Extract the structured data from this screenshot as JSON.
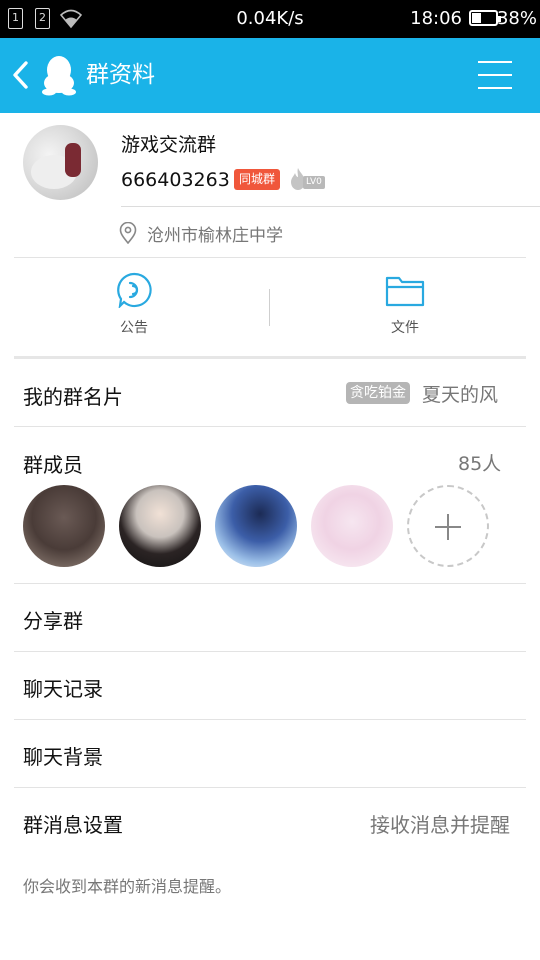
{
  "status_bar": {
    "sim1": "1",
    "sim2": "2",
    "net_speed": "0.04K/s",
    "time": "18:06",
    "battery": "38%"
  },
  "header": {
    "title": "群资料",
    "back_icon": "chevron-left-icon",
    "menu_icon": "hamburger-menu-icon",
    "bg_color": "#1ab3e8"
  },
  "group": {
    "name": "游戏交流群",
    "id": "666403263",
    "city_badge": "同城群",
    "city_badge_color": "#f0573b",
    "level": "LV0",
    "location": "沧州市榆林庄中学"
  },
  "actions": [
    {
      "label": "公告",
      "icon": "announcement-icon"
    },
    {
      "label": "文件",
      "icon": "folder-icon"
    }
  ],
  "rows": {
    "card_label": "我的群名片",
    "card_tag": "贪吃铂金",
    "card_value": "夏天的风",
    "members_label": "群成员",
    "members_count": "85人",
    "share_label": "分享群",
    "history_label": "聊天记录",
    "background_label": "聊天背景",
    "notify_label": "群消息设置",
    "notify_value": "接收消息并提醒"
  },
  "footer_note": "你会收到本群的新消息提醒。"
}
